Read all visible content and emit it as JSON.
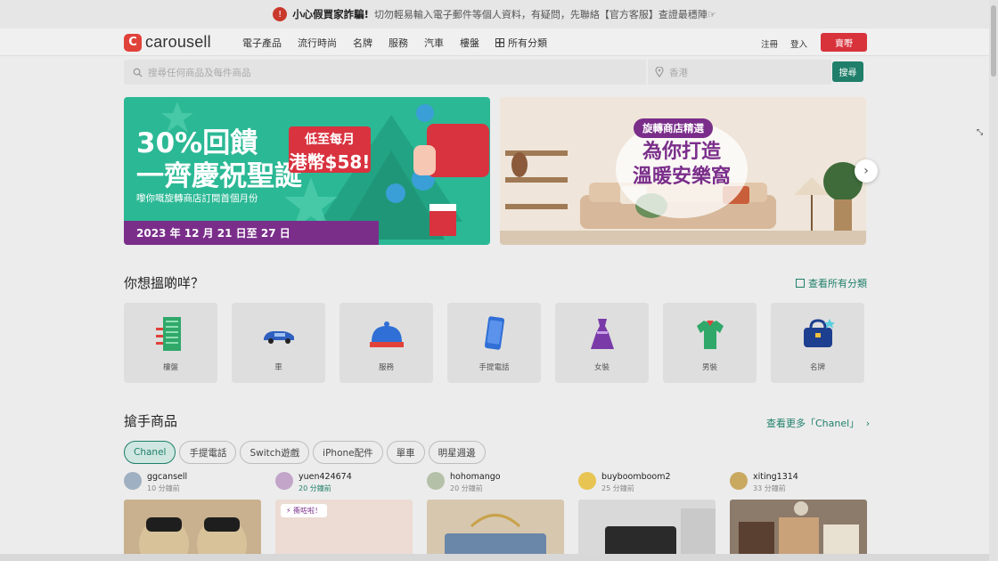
{
  "notice": {
    "title": "小心假買家詐騙!",
    "text": "切勿輕易輸入電子郵件等個人資料，有疑問，先聯絡【官方客服】查證最穩陣☞"
  },
  "header": {
    "logo": "carousell",
    "nav": [
      "電子產品",
      "流行時尚",
      "名牌",
      "服務",
      "汽車",
      "樓盤"
    ],
    "all_categories": "所有分類",
    "register": "注冊",
    "login": "登入",
    "sell": "賣嘢"
  },
  "search": {
    "placeholder": "搜尋任何商品及每件商品",
    "location": "香港",
    "button": "搜尋"
  },
  "banner1": {
    "title_line1": "30%回饋",
    "title_line2": "一齊慶祝聖誕",
    "tag_line1": "低至每月",
    "tag_line2": "港幣$58!",
    "subtitle": "嚟你嘅旋轉商店訂閱首個月份",
    "date": "2023 年 12 月 21 日至 27 日"
  },
  "banner2": {
    "badge": "旋轉商店精選",
    "title_line1": "為你打造",
    "title_line2": "溫暖安樂窩"
  },
  "categories": {
    "title": "你想搵啲咩？",
    "view_all": "查看所有分類",
    "items": [
      {
        "label": "樓盤",
        "icon": "building-icon"
      },
      {
        "label": "車",
        "icon": "car-icon"
      },
      {
        "label": "服務",
        "icon": "service-bell-icon"
      },
      {
        "label": "手提電話",
        "icon": "phone-icon"
      },
      {
        "label": "女裝",
        "icon": "dress-icon"
      },
      {
        "label": "男裝",
        "icon": "tshirt-icon"
      },
      {
        "label": "名牌",
        "icon": "bag-icon"
      }
    ]
  },
  "hot": {
    "title": "搶手商品",
    "view_more": "查看更多「Chanel」",
    "chips": [
      "Chanel",
      "手提電話",
      "Switch遊戲",
      "iPhone配件",
      "單車",
      "明星週邊"
    ],
    "listings": [
      {
        "name": "ggcansell",
        "time": "10 分鐘前",
        "boost": ""
      },
      {
        "name": "yuen424674",
        "time": "20 分鐘前",
        "boost": "衝咗啦！"
      },
      {
        "name": "hohomango",
        "time": "20 分鐘前",
        "boost": ""
      },
      {
        "name": "buyboomboom2",
        "time": "25 分鐘前",
        "boost": ""
      },
      {
        "name": "xiting1314",
        "time": "33 分鐘前",
        "boost": ""
      }
    ]
  },
  "colors": {
    "brand": "#d8323b",
    "accent": "#1f7f6a",
    "banner_green": "#2bb895",
    "banner_purple": "#7a2e8a"
  }
}
